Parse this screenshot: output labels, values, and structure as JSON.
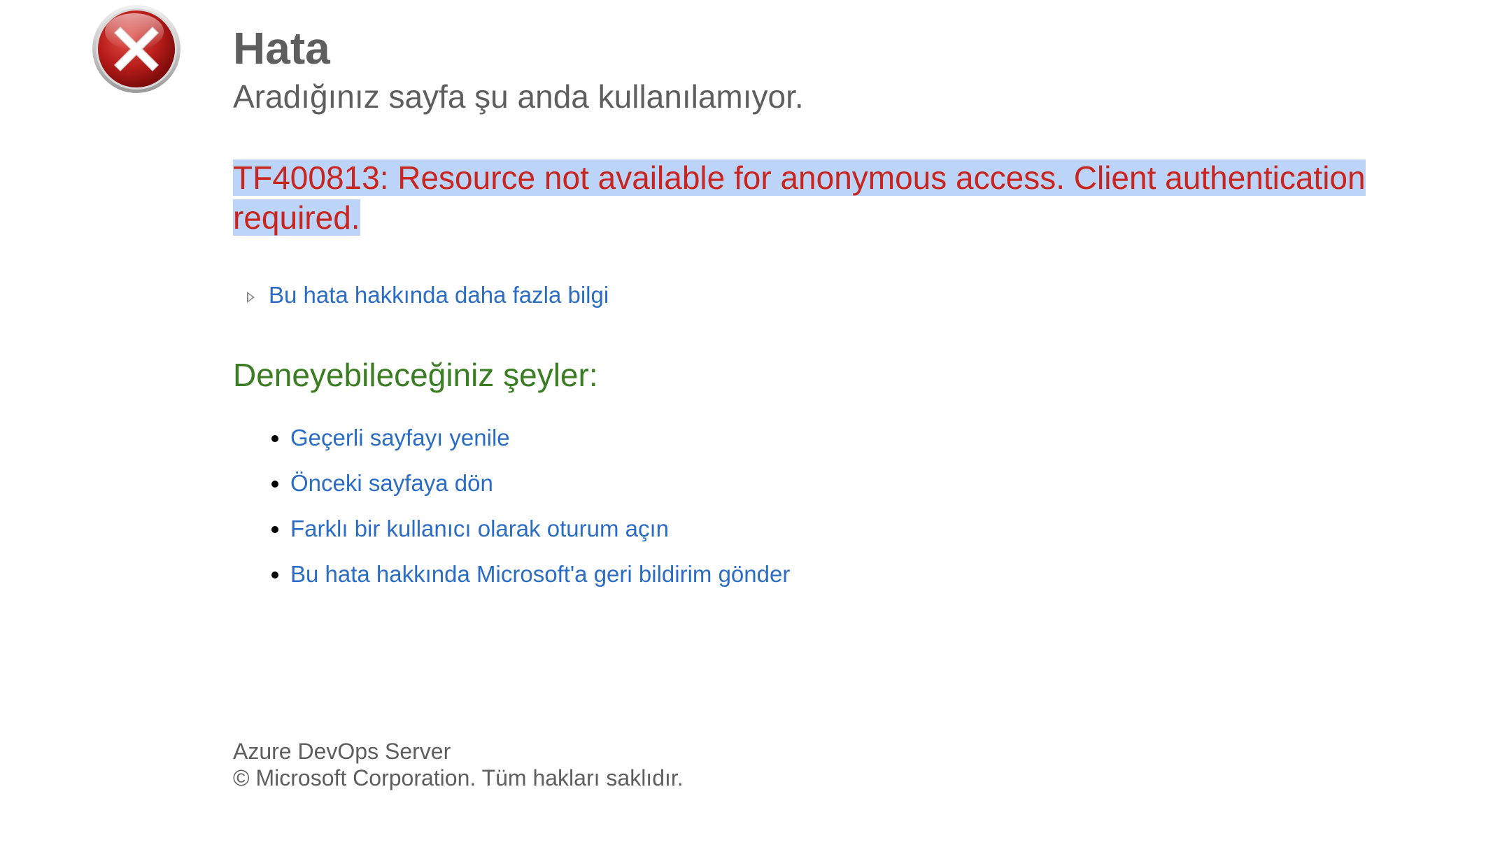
{
  "header": {
    "icon": "error-x-icon",
    "title": "Hata",
    "subtitle": "Aradığınız sayfa şu anda kullanılamıyor."
  },
  "error": {
    "message": "TF400813: Resource not available for anonymous access. Client authentication required."
  },
  "more_info": {
    "label": "Bu hata hakkında daha fazla bilgi"
  },
  "suggestions": {
    "heading": "Deneyebileceğiniz şeyler:",
    "items": [
      {
        "label": "Geçerli sayfayı yenile"
      },
      {
        "label": "Önceki sayfaya dön"
      },
      {
        "label": "Farklı bir kullanıcı olarak oturum açın"
      },
      {
        "label": "Bu hata hakkında Microsoft'a geri bildirim gönder"
      }
    ]
  },
  "footer": {
    "product": "Azure DevOps Server",
    "copyright": "© Microsoft Corporation. Tüm hakları saklıdır."
  },
  "colors": {
    "title": "#5e5e5e",
    "error": "#c8251e",
    "selection": "#bcd4f8",
    "link": "#2b6cc4",
    "heading_green": "#3a7d22"
  }
}
